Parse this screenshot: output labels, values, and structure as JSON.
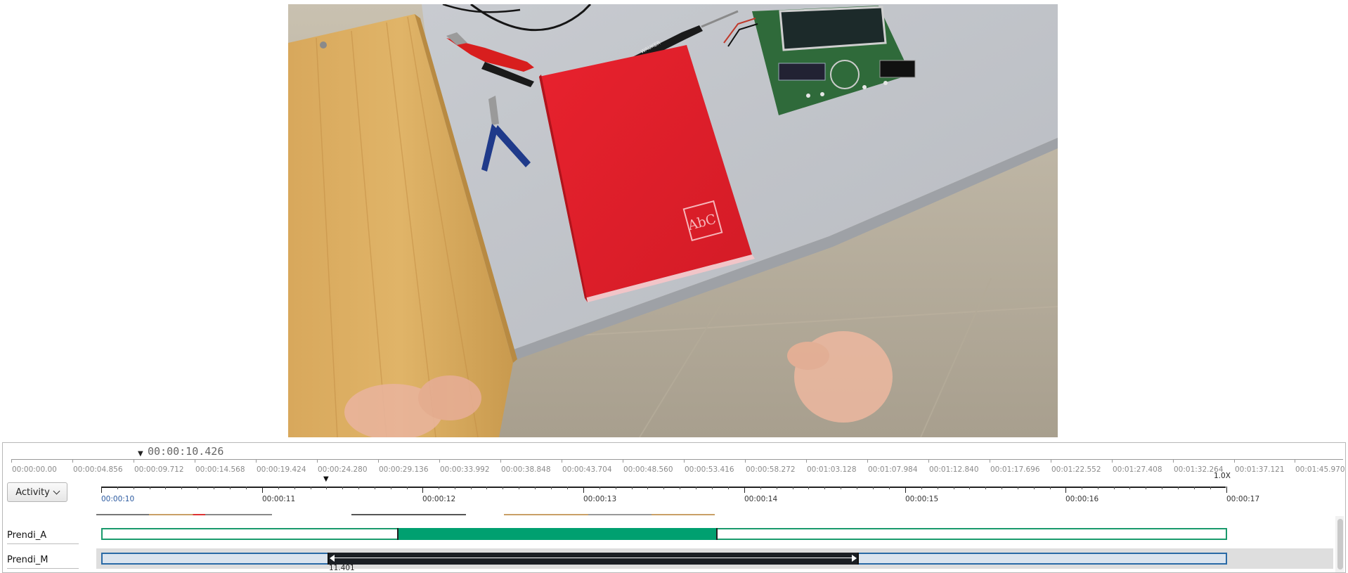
{
  "video": {
    "book_logo_text": "AbC",
    "screwdriver_brand": "WAUKER"
  },
  "timeline": {
    "current_time": "00:00:10.426",
    "overview_ticks": [
      "00:00:00.00",
      "00:00:04.856",
      "00:00:09.712",
      "00:00:14.568",
      "00:00:19.424",
      "00:00:24.280",
      "00:00:29.136",
      "00:00:33.992",
      "00:00:38.848",
      "00:00:43.704",
      "00:00:48.560",
      "00:00:53.416",
      "00:00:58.272",
      "00:01:03.128",
      "00:01:07.984",
      "00:01:12.840",
      "00:01:17.696",
      "00:01:22.552",
      "00:01:27.408",
      "00:01:32.264",
      "00:01:37.121",
      "00:01:45.970"
    ],
    "zoom_ticks": [
      "00:00:10",
      "00:00:11",
      "00:00:12",
      "00:00:13",
      "00:00:14",
      "00:00:15",
      "00:00:16",
      "00:00:17"
    ],
    "speed": "1.0X",
    "activity_button": "Activity",
    "tracks": [
      {
        "label": "Prendi_A",
        "color": "#00a070"
      },
      {
        "label": "Prendi_M",
        "color": "#1b1f24",
        "segment_start_label": "11.401"
      }
    ]
  }
}
